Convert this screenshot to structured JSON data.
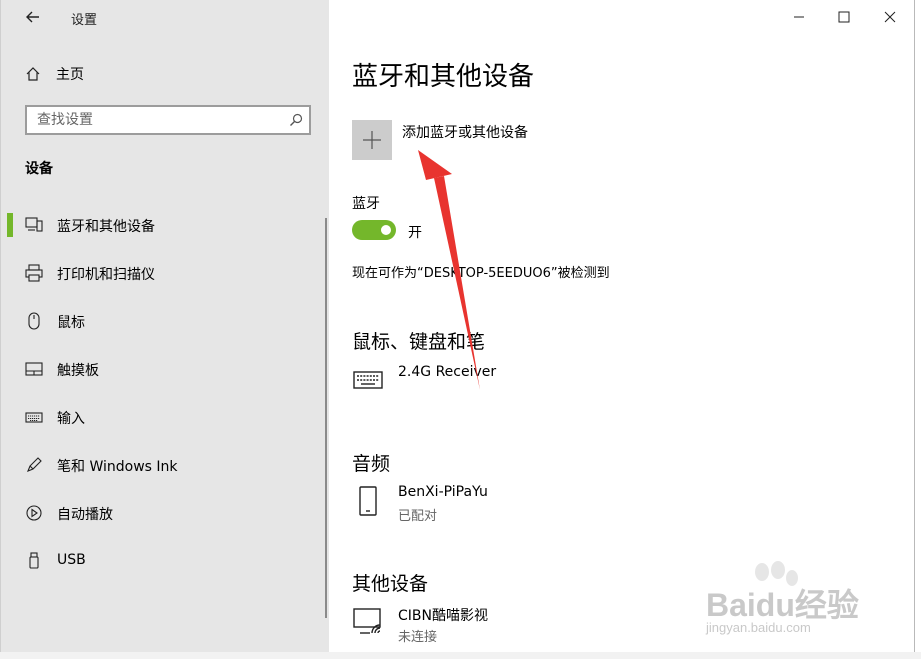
{
  "window": {
    "title": "设置",
    "accent_color": "#74b72b"
  },
  "sidebar": {
    "home_label": "主页",
    "search_placeholder": "查找设置",
    "section_title": "设备",
    "items": [
      {
        "label": "蓝牙和其他设备",
        "icon": "bluetooth-devices-icon",
        "active": true
      },
      {
        "label": "打印机和扫描仪",
        "icon": "printer-icon",
        "active": false
      },
      {
        "label": "鼠标",
        "icon": "mouse-icon",
        "active": false
      },
      {
        "label": "触摸板",
        "icon": "touchpad-icon",
        "active": false
      },
      {
        "label": "输入",
        "icon": "keyboard-icon",
        "active": false
      },
      {
        "label": "笔和 Windows Ink",
        "icon": "pen-icon",
        "active": false
      },
      {
        "label": "自动播放",
        "icon": "autoplay-icon",
        "active": false
      },
      {
        "label": "USB",
        "icon": "usb-icon",
        "active": false
      }
    ]
  },
  "main": {
    "title": "蓝牙和其他设备",
    "add_device_label": "添加蓝牙或其他设备",
    "bluetooth_label": "蓝牙",
    "bluetooth_state": "开",
    "discoverable_text": "现在可作为“DESKTOP-5EEDUO6”被检测到",
    "groups": [
      {
        "title": "鼠标、键盘和笔",
        "devices": [
          {
            "name": "2.4G Receiver",
            "status": "",
            "icon": "keyboard-icon"
          }
        ]
      },
      {
        "title": "音频",
        "devices": [
          {
            "name": "BenXi-PiPaYu",
            "status": "已配对",
            "icon": "phone-icon"
          }
        ]
      },
      {
        "title": "其他设备",
        "devices": [
          {
            "name": "CIBN酷喵影视",
            "status": "未连接",
            "icon": "wireless-display-icon"
          }
        ]
      }
    ]
  },
  "watermark": {
    "brand": "Baidu经验",
    "url": "jingyan.baidu.com"
  }
}
